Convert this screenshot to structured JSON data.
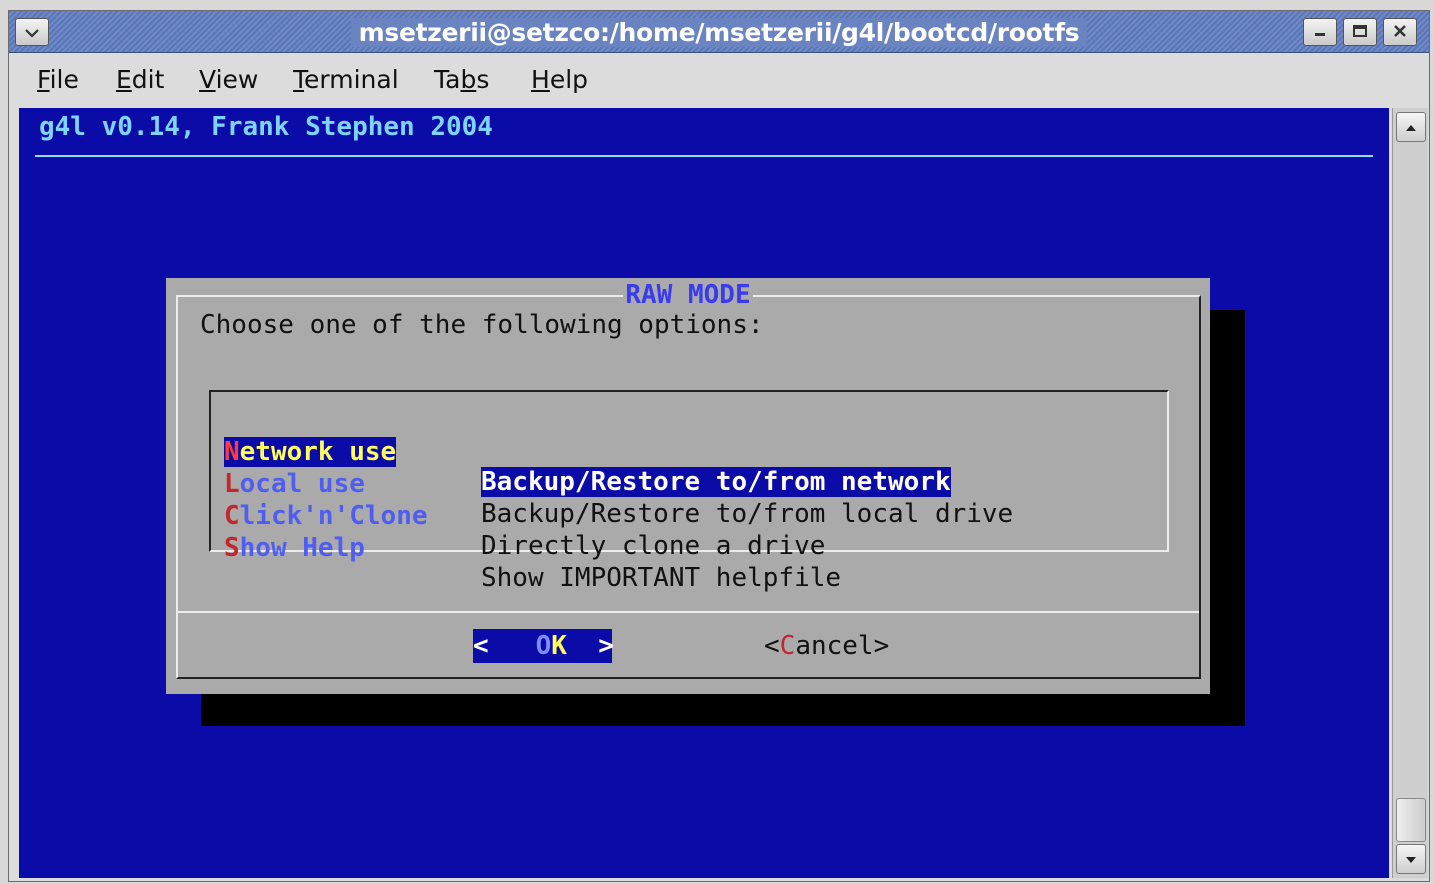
{
  "window": {
    "title": "msetzerii@setzco:/home/msetzerii/g4l/bootcd/rootfs"
  },
  "menubar": {
    "items": [
      {
        "label": "File",
        "mnemonic": "F"
      },
      {
        "label": "Edit",
        "mnemonic": "E"
      },
      {
        "label": "View",
        "mnemonic": "V"
      },
      {
        "label": "Terminal",
        "mnemonic": "T"
      },
      {
        "label": "Tabs",
        "mnemonic": "b"
      },
      {
        "label": "Help",
        "mnemonic": "H"
      }
    ]
  },
  "terminal": {
    "header": "g4l v0.14, Frank Stephen 2004",
    "background_color": "#0b0ba8"
  },
  "dialog": {
    "title": "RAW MODE",
    "prompt": "Choose one of the following options:",
    "options": [
      {
        "tag_hot": "N",
        "tag_rest": "etwork use",
        "desc": "Backup/Restore to/from network",
        "selected": true
      },
      {
        "tag_hot": "L",
        "tag_rest": "ocal use",
        "desc": "Backup/Restore to/from local drive",
        "selected": false
      },
      {
        "tag_hot": "C",
        "tag_rest": "lick'n'Clone",
        "desc": "Directly clone a drive",
        "selected": false
      },
      {
        "tag_hot": "S",
        "tag_rest": "how Help",
        "desc": "Show IMPORTANT helpfile",
        "selected": false
      }
    ],
    "ok_button": {
      "left": "<",
      "pre": "O",
      "hot": "K",
      "right": ">"
    },
    "cancel_button": {
      "open": "<",
      "hot": "C",
      "rest": "ancel",
      "close": ">"
    }
  },
  "icons": {
    "window_menu": "chevron-down-icon",
    "minimize": "minimize-icon",
    "maximize": "maximize-icon",
    "close": "close-icon",
    "scroll_up": "arrow-up-icon",
    "scroll_down": "arrow-down-icon"
  }
}
